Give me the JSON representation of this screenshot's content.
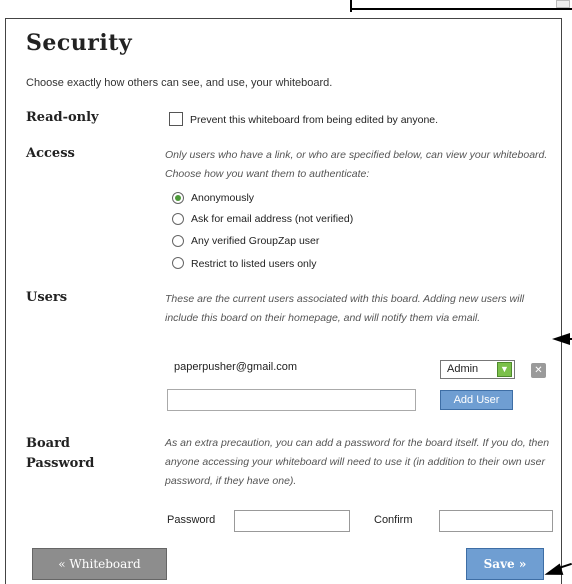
{
  "security": {
    "title": "Security",
    "intro": "Choose exactly how others can see, and use, your whiteboard."
  },
  "read_only": {
    "label": "Read-only",
    "checkbox_label": "Prevent this whiteboard from being edited by anyone.",
    "checked": false
  },
  "access": {
    "label": "Access",
    "description": "Only users who have a link, or who are specified below, can view your whiteboard. Choose how you want them to authenticate:",
    "options": [
      {
        "label": "Anonymously",
        "selected": true
      },
      {
        "label": "Ask for email address (not verified)",
        "selected": false
      },
      {
        "label": "Any verified GroupZap user",
        "selected": false
      },
      {
        "label": "Restrict to listed users only",
        "selected": false
      }
    ]
  },
  "users": {
    "label": "Users",
    "description": "These are the current users associated with this board. Adding new users will include this board on their homepage, and will notify them via email.",
    "rows": [
      {
        "email": "paperpusher@gmail.com",
        "role": "Admin"
      }
    ],
    "add_input_value": "",
    "add_button_label": "Add User"
  },
  "board_password": {
    "label_line1": "Board",
    "label_line2": "Password",
    "description": "As an extra precaution, you can add a password for the board itself. If you do, then anyone accessing your whiteboard will need to use it (in addition to their own user password, if they have one).",
    "password_label": "Password",
    "confirm_label": "Confirm",
    "password_value": "",
    "confirm_value": ""
  },
  "footer": {
    "back_label": "« Whiteboard",
    "save_label": "Save »"
  },
  "colors": {
    "accent_blue": "#6f9ed2",
    "radio_green": "#4d9a3a",
    "select_green": "#7bc04a",
    "button_gray": "#8d8d8d"
  }
}
